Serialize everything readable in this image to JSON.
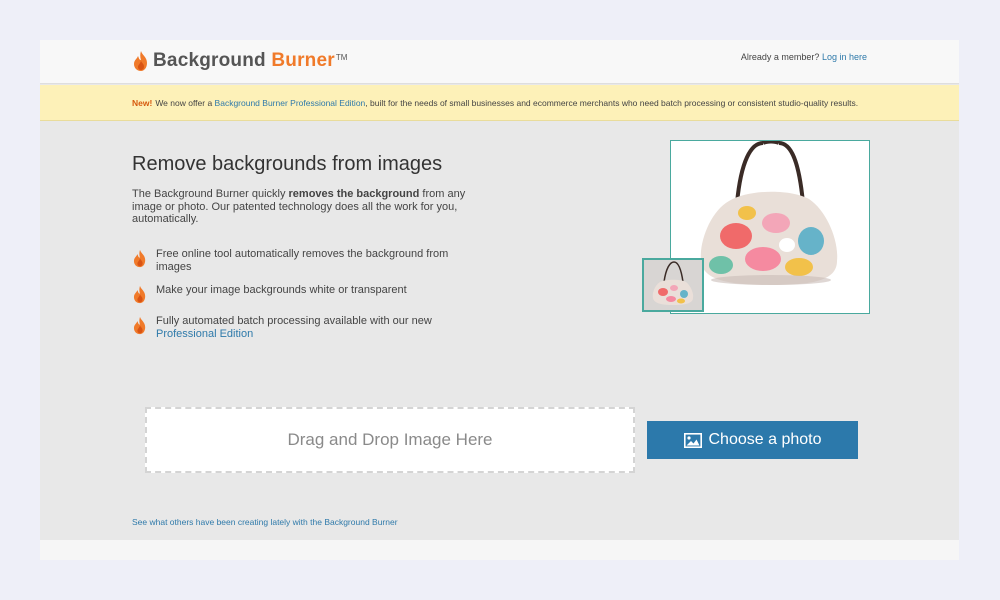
{
  "header": {
    "logo_text_1": "Background",
    "logo_text_2": "Burner",
    "logo_tm": "TM",
    "member_text": "Already a member?",
    "login_link": "Log in here"
  },
  "banner": {
    "new_label": "New!",
    "text_before": "We now offer a",
    "link": "Background Burner Professional Edition",
    "text_after": ", built for the needs of small businesses and ecommerce merchants who need batch processing or consistent studio-quality results."
  },
  "main": {
    "headline": "Remove backgrounds from images",
    "intro_before": "The Background Burner quickly",
    "intro_bold": "removes the background",
    "intro_after": "from any image or photo. Our patented technology does all the work for you, automatically.",
    "features": [
      {
        "text": "Free online tool automatically removes the background from images"
      },
      {
        "text": "Make your image backgrounds white or transparent"
      },
      {
        "text": "Fully automated batch processing available with our new",
        "link": "Professional Edition"
      }
    ]
  },
  "upload": {
    "dropzone_text": "Drag and Drop Image Here",
    "choose_button": "Choose a photo",
    "choose_icon": "image-icon"
  },
  "gallery_link": "See what others have been creating lately with the Background Burner",
  "colors": {
    "brand_orange": "#f07a2a",
    "link_blue": "#2f7aaa",
    "button_blue": "#2c79ab",
    "banner_yellow": "#fdf1b8",
    "frame_teal": "#4aa99e"
  }
}
